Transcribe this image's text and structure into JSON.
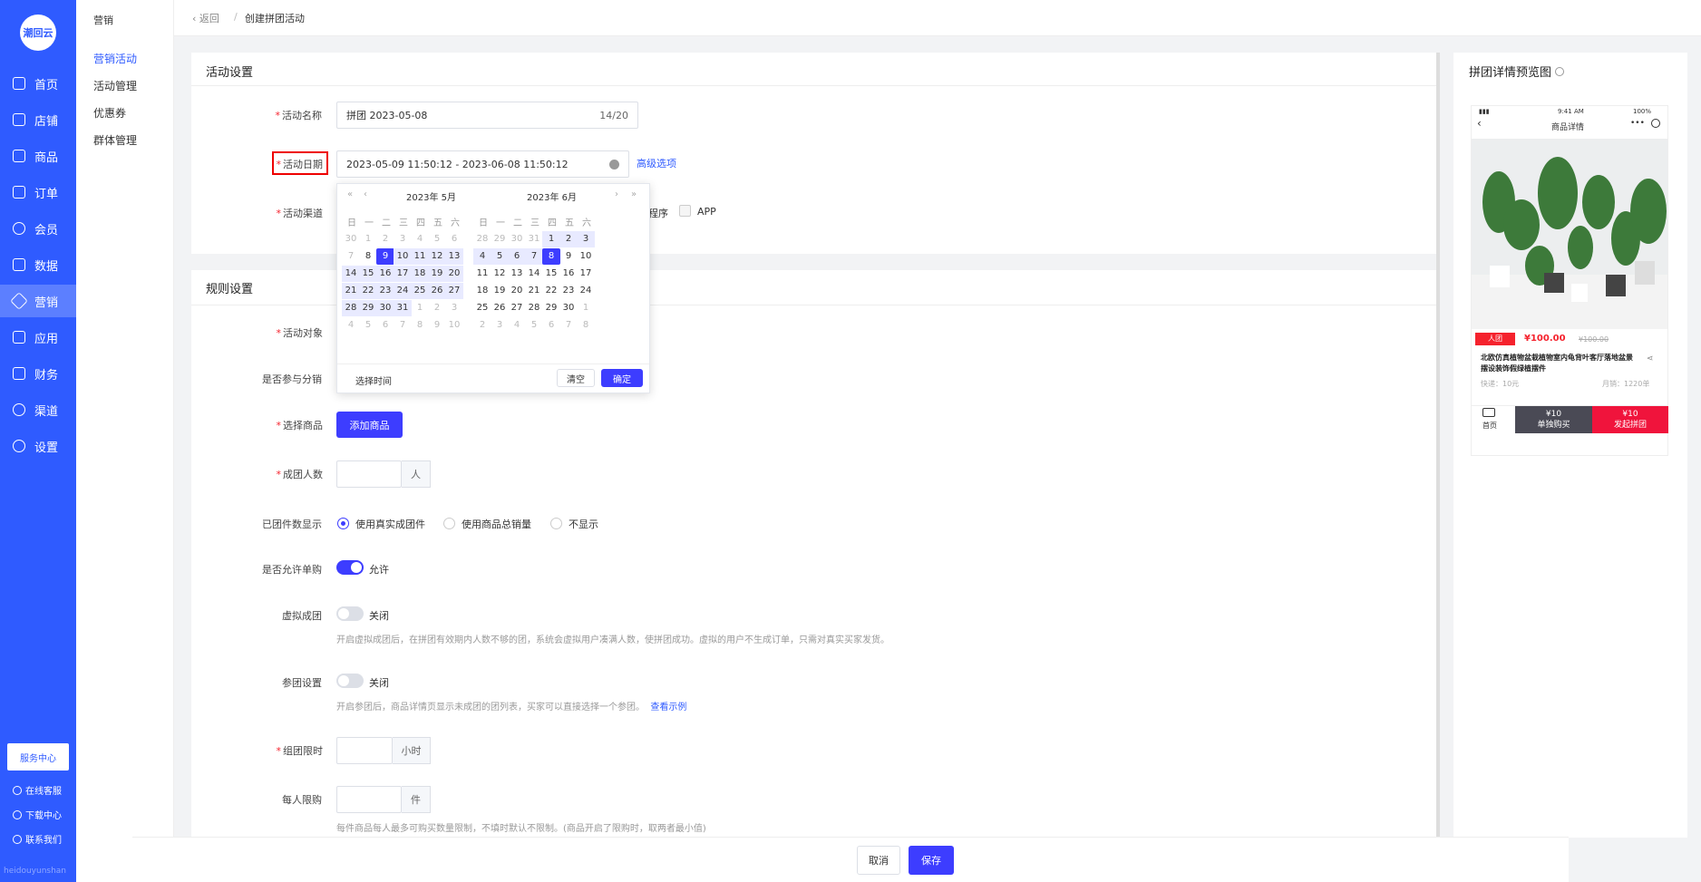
{
  "rail": {
    "logo": "潮回云",
    "items": [
      {
        "label": "首页"
      },
      {
        "label": "店铺"
      },
      {
        "label": "商品"
      },
      {
        "label": "订单"
      },
      {
        "label": "会员"
      },
      {
        "label": "数据"
      },
      {
        "label": "营销"
      },
      {
        "label": "应用"
      },
      {
        "label": "财务"
      },
      {
        "label": "渠道"
      },
      {
        "label": "设置"
      }
    ],
    "service": "服务中心",
    "links": [
      "在线客服",
      "下载中心",
      "联系我们"
    ],
    "footer": "heidouyunshan"
  },
  "subnav": {
    "title": "营销",
    "items": [
      "营销活动",
      "活动管理",
      "优惠券",
      "群体管理"
    ]
  },
  "breadcrumb": {
    "back": "返回",
    "current": "创建拼团活动"
  },
  "activity": {
    "section": "活动设置",
    "name_label": "活动名称",
    "name_value": "拼团  2023-05-08",
    "name_count": "14/20",
    "date_label": "活动日期",
    "date_value": "2023-05-09 11:50:12 - 2023-06-08 11:50:12",
    "advanced": "高级选项",
    "channel_label": "活动渠道",
    "channel_miniapp": "程序",
    "channel_app": "APP"
  },
  "picker": {
    "left_title": "2023年 5月",
    "right_title": "2023年 6月",
    "weekdays": [
      "日",
      "一",
      "二",
      "三",
      "四",
      "五",
      "六"
    ],
    "select_time": "选择时间",
    "clear": "清空",
    "ok": "确定",
    "left_days": [
      [
        "30",
        "1",
        "2",
        "3",
        "4",
        "5",
        "6"
      ],
      [
        "7",
        "8",
        "9",
        "10",
        "11",
        "12",
        "13"
      ],
      [
        "14",
        "15",
        "16",
        "17",
        "18",
        "19",
        "20"
      ],
      [
        "21",
        "22",
        "23",
        "24",
        "25",
        "26",
        "27"
      ],
      [
        "28",
        "29",
        "30",
        "31",
        "1",
        "2",
        "3"
      ],
      [
        "4",
        "5",
        "6",
        "7",
        "8",
        "9",
        "10"
      ]
    ],
    "right_days": [
      [
        "28",
        "29",
        "30",
        "31",
        "1",
        "2",
        "3"
      ],
      [
        "4",
        "5",
        "6",
        "7",
        "8",
        "9",
        "10"
      ],
      [
        "11",
        "12",
        "13",
        "14",
        "15",
        "16",
        "17"
      ],
      [
        "18",
        "19",
        "20",
        "21",
        "22",
        "23",
        "24"
      ],
      [
        "25",
        "26",
        "27",
        "28",
        "29",
        "30",
        "1"
      ],
      [
        "2",
        "3",
        "4",
        "5",
        "6",
        "7",
        "8"
      ]
    ]
  },
  "rules": {
    "section": "规则设置",
    "target_label": "活动对象",
    "distribution_label": "是否参与分销",
    "goods_label": "选择商品",
    "add_goods": "添加商品",
    "size_label": "成团人数",
    "size_unit": "人",
    "count_label": "已团件数显示",
    "count_opt1": "使用真实成团件",
    "count_opt2": "使用商品总销量",
    "count_opt3": "不显示",
    "single_label": "是否允许单购",
    "single_value": "允许",
    "virtual_label": "虚拟成团",
    "virtual_value": "关闭",
    "virtual_hint": "开启虚拟成团后，在拼团有效期内人数不够的团，系统会虚拟用户凑满人数，使拼团成功。虚拟的用户不生成订单，只需对真实买家发货。",
    "join_label": "参团设置",
    "join_value": "关闭",
    "join_hint": "开启参团后，商品详情页显示未成团的团列表，买家可以直接选择一个参团。",
    "join_link": "查看示例",
    "limit_label": "组团限时",
    "limit_unit": "小时",
    "per_label": "每人限购",
    "per_unit": "件",
    "per_hint": "每件商品每人最多可购买数量限制，不填时默认不限制。(商品开启了限购时，取两者最小值)"
  },
  "preview": {
    "title": "拼团详情预览图",
    "status_time": "9:41 AM",
    "status_battery": "100%",
    "page_title": "商品详情",
    "badge": "人团",
    "price": "¥100.00",
    "old_price": "¥100.00",
    "product": "北欧仿真植物盆栽植物室内龟背叶客厅落地盆景摆设装饰假绿植摆件",
    "shipping": "快递：10元",
    "sales": "月销：1220单",
    "home": "首页",
    "buy_price": "¥10",
    "buy_label": "单独购买",
    "group_price": "¥10",
    "group_label": "发起拼团"
  },
  "footer": {
    "cancel": "取消",
    "save": "保存"
  },
  "colors": {
    "primary": "#3d3dff",
    "rail": "#2f5bff",
    "danger": "#f5222d"
  }
}
